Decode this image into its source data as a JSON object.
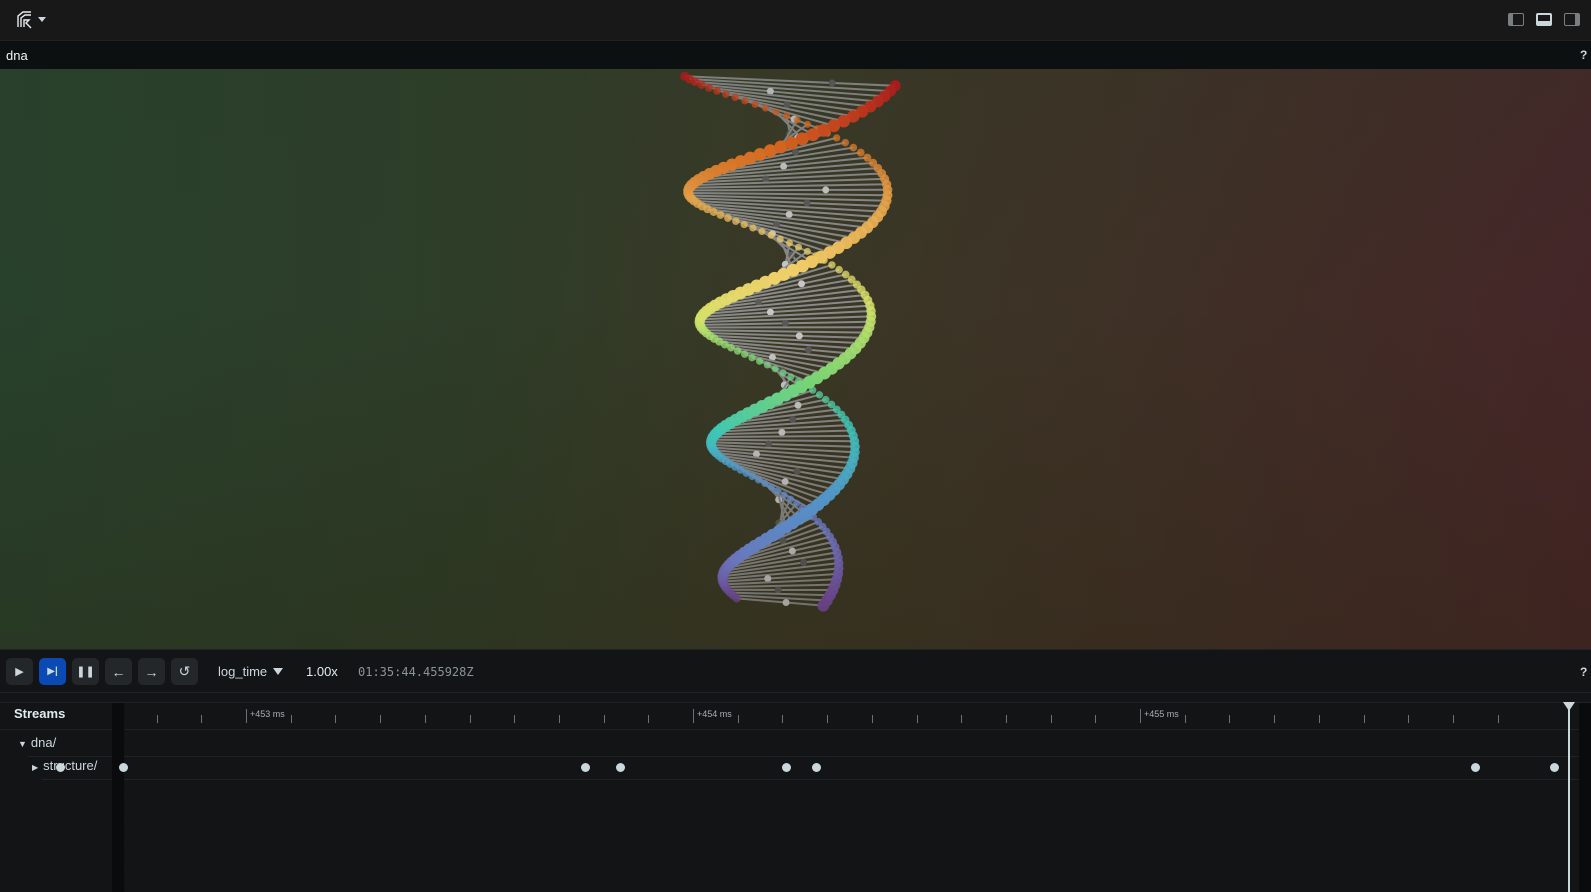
{
  "app": {
    "logo_icon": "rerun-logo-icon",
    "menu_caret_icon": "caret-down-icon",
    "panel_toggles": [
      {
        "name": "left-panel-toggle",
        "icon": "left-panel-icon",
        "active": false
      },
      {
        "name": "bottom-panel-toggle",
        "icon": "bottom-panel-icon",
        "active": true
      },
      {
        "name": "right-panel-toggle",
        "icon": "right-panel-icon",
        "active": false
      }
    ]
  },
  "view": {
    "title": "dna",
    "help": "?",
    "scene": "3D DNA double helix with colored spheres and gray connecting rods",
    "helix_colors": [
      "#c4151a",
      "#e8701e",
      "#f0a64a",
      "#f4d06a",
      "#d4e46a",
      "#7fe07a",
      "#3fd8c8",
      "#5aa8e8",
      "#7a8ae6",
      "#7a4aa8"
    ]
  },
  "controls": {
    "buttons": [
      {
        "name": "play-button",
        "icon": "play-icon",
        "glyph": "▶",
        "active": false
      },
      {
        "name": "follow-button",
        "icon": "step-to-end-icon",
        "glyph": "▶|",
        "active": true
      },
      {
        "name": "pause-button",
        "icon": "pause-icon",
        "glyph": "❚❚",
        "active": false
      },
      {
        "name": "step-back-button",
        "icon": "arrow-left-icon",
        "glyph": "←",
        "active": false
      },
      {
        "name": "step-forward-button",
        "icon": "arrow-right-icon",
        "glyph": "→",
        "active": false
      },
      {
        "name": "loop-button",
        "icon": "loop-icon",
        "glyph": "↺",
        "active": false
      }
    ],
    "timeline": "log_time",
    "speed": "1.00x",
    "timestamp": "01:35:44.455928Z",
    "help": "?"
  },
  "streams": {
    "title": "Streams",
    "tree": [
      {
        "label": "dna/",
        "expanded": true,
        "depth": 0
      },
      {
        "label": "structure/",
        "expanded": false,
        "depth": 1
      }
    ],
    "ruler_labels": [
      "+453 ms",
      "+454 ms",
      "+455 ms"
    ],
    "events_ms_offset": [
      452.584,
      452.727,
      453.76,
      453.838,
      454.21,
      454.277,
      455.75,
      455.928
    ]
  }
}
